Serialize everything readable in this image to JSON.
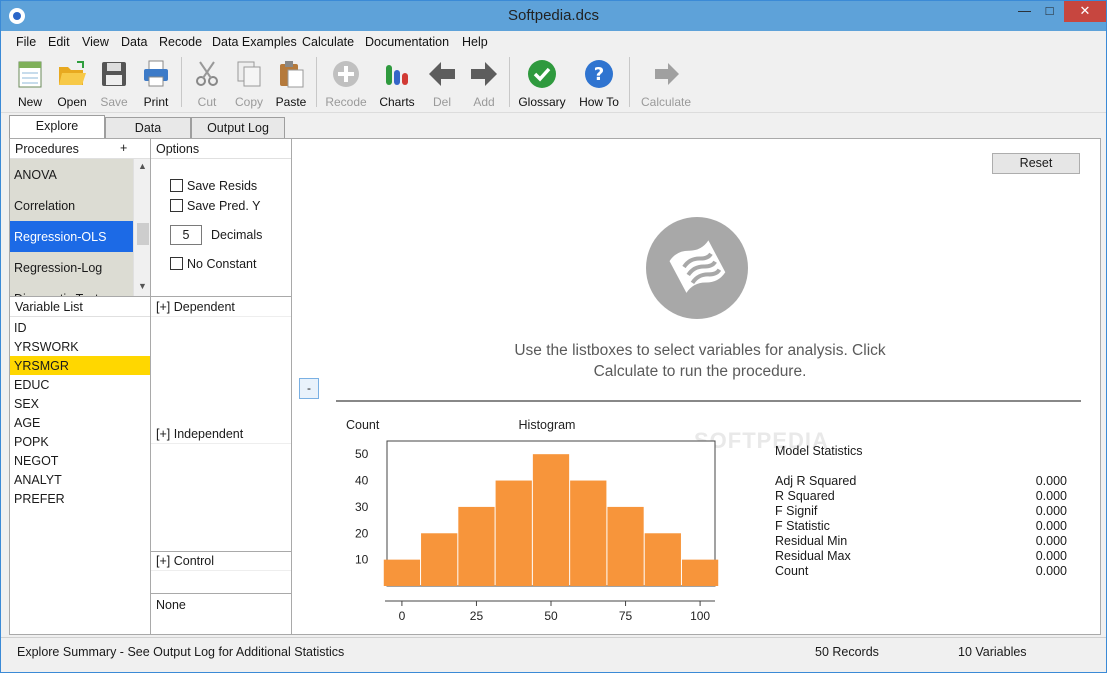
{
  "window": {
    "title": "Softpedia.dcs",
    "min": "—",
    "max": "□",
    "close": "✕"
  },
  "menu": [
    "File",
    "Edit",
    "View",
    "Data",
    "Recode",
    "Data Examples",
    "Calculate",
    "Documentation",
    "Help"
  ],
  "toolbar": {
    "new": "New",
    "open": "Open",
    "save": "Save",
    "print": "Print",
    "cut": "Cut",
    "copy": "Copy",
    "paste": "Paste",
    "recode": "Recode",
    "charts": "Charts",
    "del": "Del",
    "add": "Add",
    "glossary": "Glossary",
    "howto": "How To",
    "calculate": "Calculate"
  },
  "tabs": [
    "Explore",
    "Data",
    "Output Log"
  ],
  "procedures": {
    "header": "Procedures",
    "plus": "+",
    "items": [
      "ANOVA",
      "Correlation",
      "Regression-OLS",
      "Regression-Log",
      "Diagnostic Tests"
    ],
    "selected": "Regression-OLS"
  },
  "options": {
    "header": "Options",
    "save_resids": "Save Resids",
    "save_pred": "Save Pred. Y",
    "decimals_value": "5",
    "decimals_label": "Decimals",
    "no_constant": "No Constant"
  },
  "variables": {
    "header": "Variable List",
    "items": [
      "ID",
      "YRSWORK",
      "YRSMGR",
      "EDUC",
      "SEX",
      "AGE",
      "POPK",
      "NEGOT",
      "ANALYT",
      "PREFER"
    ],
    "selected": "YRSMGR"
  },
  "roles": {
    "dependent": "[+] Dependent",
    "independent": "[+] Independent",
    "control": "[+] Control",
    "none": "None"
  },
  "main": {
    "reset": "Reset",
    "minus": "-",
    "instruction_line1": "Use the listboxes to select variables for analysis.  Click",
    "instruction_line2": "Calculate to run the procedure.",
    "watermark": "SOFTPEDIA"
  },
  "chart_data": {
    "type": "bar",
    "title": "Histogram",
    "ylabel": "Count",
    "xlabel": "",
    "x_ticks": [
      0,
      25,
      50,
      75,
      100
    ],
    "y_ticks": [
      10,
      20,
      30,
      40,
      50
    ],
    "ylim": [
      0,
      55
    ],
    "xlim": [
      -5,
      105
    ],
    "bins": [
      {
        "center": 0,
        "value": 10
      },
      {
        "center": 12.5,
        "value": 20
      },
      {
        "center": 25,
        "value": 30
      },
      {
        "center": 37.5,
        "value": 40
      },
      {
        "center": 50,
        "value": 50
      },
      {
        "center": 62.5,
        "value": 40
      },
      {
        "center": 75,
        "value": 30
      },
      {
        "center": 87.5,
        "value": 20
      },
      {
        "center": 100,
        "value": 10
      }
    ],
    "bar_color": "#f7953b"
  },
  "stats": {
    "title": "Model Statistics",
    "rows": [
      {
        "label": "Adj R Squared",
        "value": "0.000"
      },
      {
        "label": "R Squared",
        "value": "0.000"
      },
      {
        "label": "F Signif",
        "value": "0.000"
      },
      {
        "label": "F Statistic",
        "value": "0.000"
      },
      {
        "label": "Residual Min",
        "value": "0.000"
      },
      {
        "label": "Residual Max",
        "value": "0.000"
      },
      {
        "label": "Count",
        "value": "0.000"
      }
    ]
  },
  "status": {
    "summary": "Explore Summary  -  See Output Log for Additional Statistics",
    "records": "50 Records",
    "variables": "10 Variables"
  }
}
